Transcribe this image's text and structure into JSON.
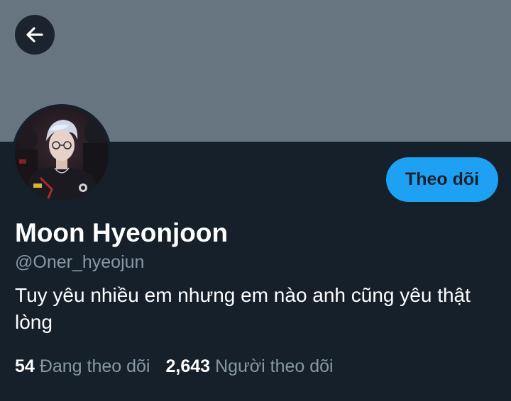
{
  "header": {
    "back_icon": "arrow-left-icon",
    "banner_color": "#66757f"
  },
  "profile": {
    "follow_label": "Theo dõi",
    "display_name": "Moon Hyeonjoon",
    "handle": "@Oner_hyeojun",
    "bio": "Tuy yêu nhiều em nhưng em nào anh cũng yêu thật lòng",
    "accent_color": "#1da1f2"
  },
  "stats": {
    "following_count": "54",
    "following_label": "Đang theo dõi",
    "followers_count": "2,643",
    "followers_label": "Người theo dõi"
  }
}
